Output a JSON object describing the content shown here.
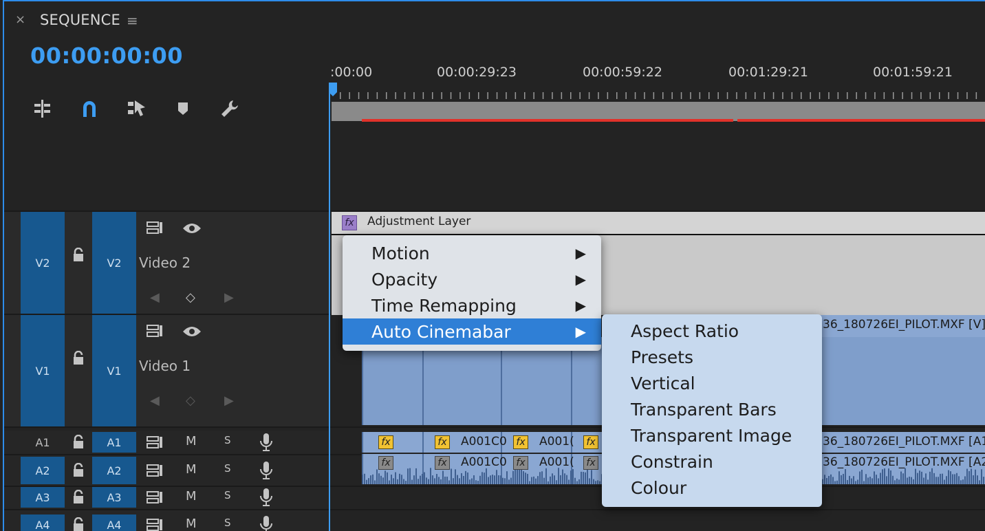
{
  "panel": {
    "close_glyph": "×",
    "title": "SEQUENCE",
    "menu_glyph": "≡",
    "timecode": "00:00:00:00",
    "accent_color": "#3d9df2"
  },
  "ruler": {
    "labels": [
      ":00:00",
      "00:00:29:23",
      "00:00:59:22",
      "00:01:29:21",
      "00:01:59:21"
    ]
  },
  "toolbar": {
    "icons": [
      "insert-nest-icon",
      "snap-magnet-icon",
      "linked-selection-icon",
      "add-marker-icon",
      "wrench-settings-icon"
    ]
  },
  "tracks": {
    "video": [
      {
        "src": "V2",
        "tgt": "V2",
        "name": "Video 2"
      },
      {
        "src": "V1",
        "tgt": "V1",
        "name": "Video 1"
      }
    ],
    "audio": [
      {
        "src": "A1",
        "tgt": "A1",
        "mute": "M",
        "solo": "S"
      },
      {
        "src": "A2",
        "tgt": "A2",
        "mute": "M",
        "solo": "S"
      },
      {
        "src": "A3",
        "tgt": "A3",
        "mute": "M",
        "solo": "S"
      },
      {
        "src": "A4",
        "tgt": "A4",
        "mute": "M",
        "solo": "S"
      }
    ]
  },
  "clips": {
    "adjustment_layer": {
      "fx": "fx",
      "label": "Adjustment Layer"
    },
    "v1_clip_name": "36_180726EI_PILOT.MXF [V]",
    "a1_clip_name": "36_180726EI_PILOT.MXF [A1",
    "a2_clip_name": "36_180726EI_PILOT.MXF [A2",
    "a_short_1": "A001C0",
    "a_short_2": "A001(",
    "fx_label": "fx"
  },
  "context_menu": {
    "items": [
      {
        "label": "Motion",
        "arrow": "▶"
      },
      {
        "label": "Opacity",
        "arrow": "▶"
      },
      {
        "label": "Time Remapping",
        "arrow": "▶"
      },
      {
        "label": "Auto Cinemabar",
        "arrow": "▶"
      }
    ],
    "active_index": 3
  },
  "submenu": {
    "items": [
      "Aspect Ratio",
      "Presets",
      "Vertical",
      "Transparent Bars",
      "Transparent Image",
      "Constrain",
      "Colour"
    ]
  }
}
